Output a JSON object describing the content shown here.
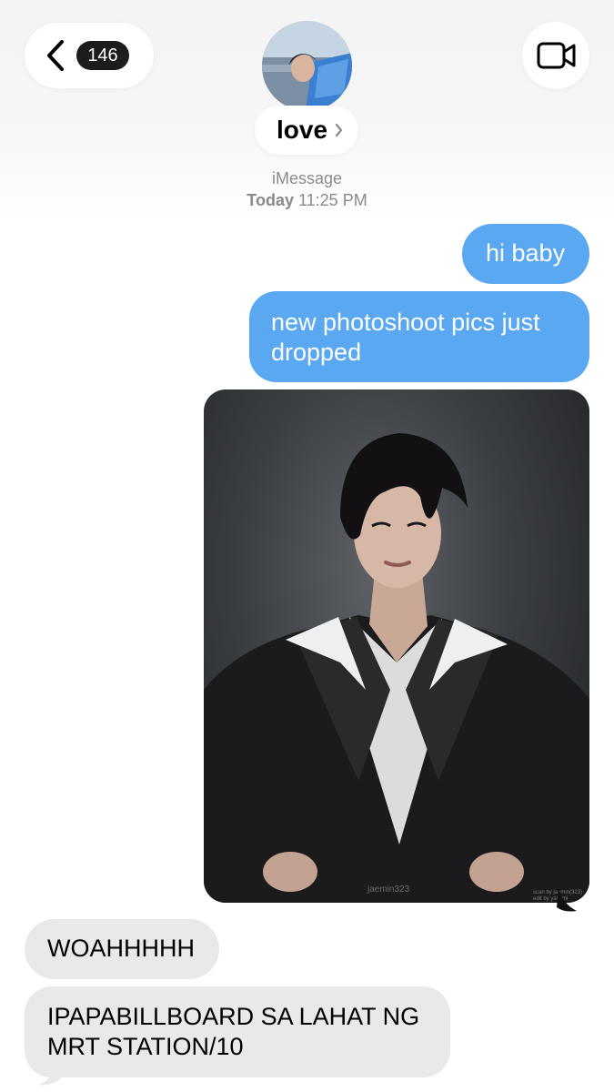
{
  "header": {
    "unread_count": "146",
    "contact_name": "love",
    "service": "iMessage",
    "date_label": "Today",
    "time_label": "11:25 PM"
  },
  "messages": [
    {
      "direction": "sent",
      "type": "text",
      "text": "hi baby"
    },
    {
      "direction": "sent",
      "type": "text",
      "text": "new photoshoot pics just dropped"
    },
    {
      "direction": "sent",
      "type": "image",
      "watermark": "jaemin323",
      "credit_line1": "scan by jaemin(323)",
      "credit_line2": "edit by yasumi"
    },
    {
      "direction": "received",
      "type": "text",
      "text": "WOAHHHHH"
    },
    {
      "direction": "received",
      "type": "text",
      "text": "IPAPABILLBOARD SA LAHAT NG MRT STATION/10"
    }
  ],
  "colors": {
    "sent_bubble": "#5aa8f2",
    "received_bubble": "#e9e9eb",
    "badge": "#1c1c1e",
    "secondary_text": "#8a8a8e"
  },
  "icons": {
    "back": "chevron-left-icon",
    "video": "video-camera-icon",
    "contact_details": "chevron-right-icon"
  }
}
